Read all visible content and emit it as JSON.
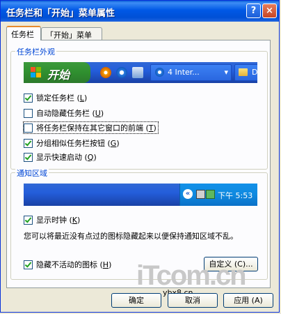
{
  "window": {
    "title": "任务栏和「开始」菜单属性",
    "help": "?",
    "close": "×"
  },
  "tabs": [
    {
      "label": "任务栏",
      "active": true
    },
    {
      "label": "「开始」菜单",
      "active": false
    }
  ],
  "taskbar_group": {
    "title": "任务栏外观",
    "preview": {
      "start_label": "开始",
      "task1": "4 Inter...",
      "task2": "D:"
    },
    "options": [
      {
        "label": "锁定任务栏 (",
        "key": "L",
        "tail": ")",
        "checked": true
      },
      {
        "label": "自动隐藏任务栏 (",
        "key": "U",
        "tail": ")",
        "checked": false
      },
      {
        "label": "将任务栏保持在其它窗口的前端 (",
        "key": "T",
        "tail": ")",
        "checked": false
      },
      {
        "label": "分组相似任务栏按钮 (",
        "key": "G",
        "tail": ")",
        "checked": true
      },
      {
        "label": "显示快速启动 (",
        "key": "Q",
        "tail": ")",
        "checked": true
      }
    ]
  },
  "notify_group": {
    "title": "通知区域",
    "tray_time": "下午 5:53",
    "clock": {
      "label": "显示时钟 (",
      "key": "K",
      "tail": ")",
      "checked": true
    },
    "description": "您可以将最近没有点过的图标隐藏起来以便保持通知区域不乱。",
    "hide_inactive": {
      "label": "隐藏不活动的图标 (",
      "key": "H",
      "tail": ")",
      "checked": true
    },
    "customize_label": "自定义 (C)..."
  },
  "buttons": {
    "ok": "确定",
    "cancel": "取消",
    "apply": "应用 (A)"
  },
  "watermark": {
    "logo": "iTcom.cn",
    "url": "ybx8.cn"
  }
}
